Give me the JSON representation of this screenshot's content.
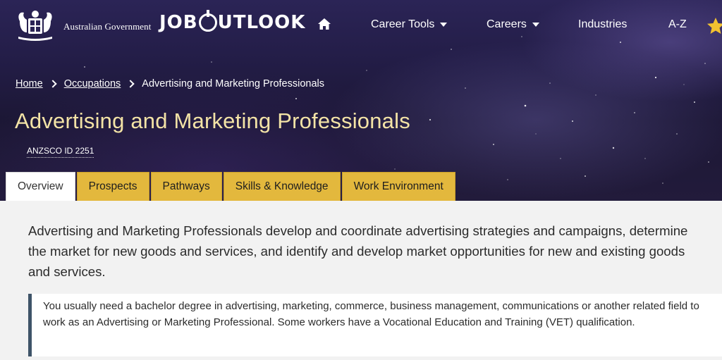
{
  "header": {
    "gov_name": "Australian Government",
    "brand_left": "JOB",
    "brand_right": "UTLOOK",
    "nav": {
      "home_icon": "home-icon",
      "career_tools": "Career Tools",
      "careers": "Careers",
      "industries": "Industries",
      "az": "A-Z",
      "star_icon": "star-icon"
    }
  },
  "breadcrumb": {
    "home": "Home",
    "occupations": "Occupations",
    "current": "Advertising and Marketing Professionals"
  },
  "page": {
    "title": "Advertising and Marketing Professionals",
    "anzsco": "ANZSCO ID 2251"
  },
  "tabs": [
    {
      "label": "Overview",
      "active": true
    },
    {
      "label": "Prospects",
      "active": false
    },
    {
      "label": "Pathways",
      "active": false
    },
    {
      "label": "Skills & Knowledge",
      "active": false
    },
    {
      "label": "Work Environment",
      "active": false
    }
  ],
  "content": {
    "intro": "Advertising and Marketing Professionals develop and coordinate advertising strategies and campaigns, determine the market for new goods and services, and identify and develop market opportunities for new and existing goods and services.",
    "callout": "You usually need a bachelor degree in advertising, marketing, commerce, business management, communications or another related field to work as an Advertising or Marketing Professional. Some workers have a Vocational Education and Training (VET) qualification."
  },
  "colors": {
    "title_gold": "#f3e3a6",
    "tab_gold": "#e3b83d",
    "callout_border": "#3e5368",
    "star_yellow": "#f2c230"
  }
}
